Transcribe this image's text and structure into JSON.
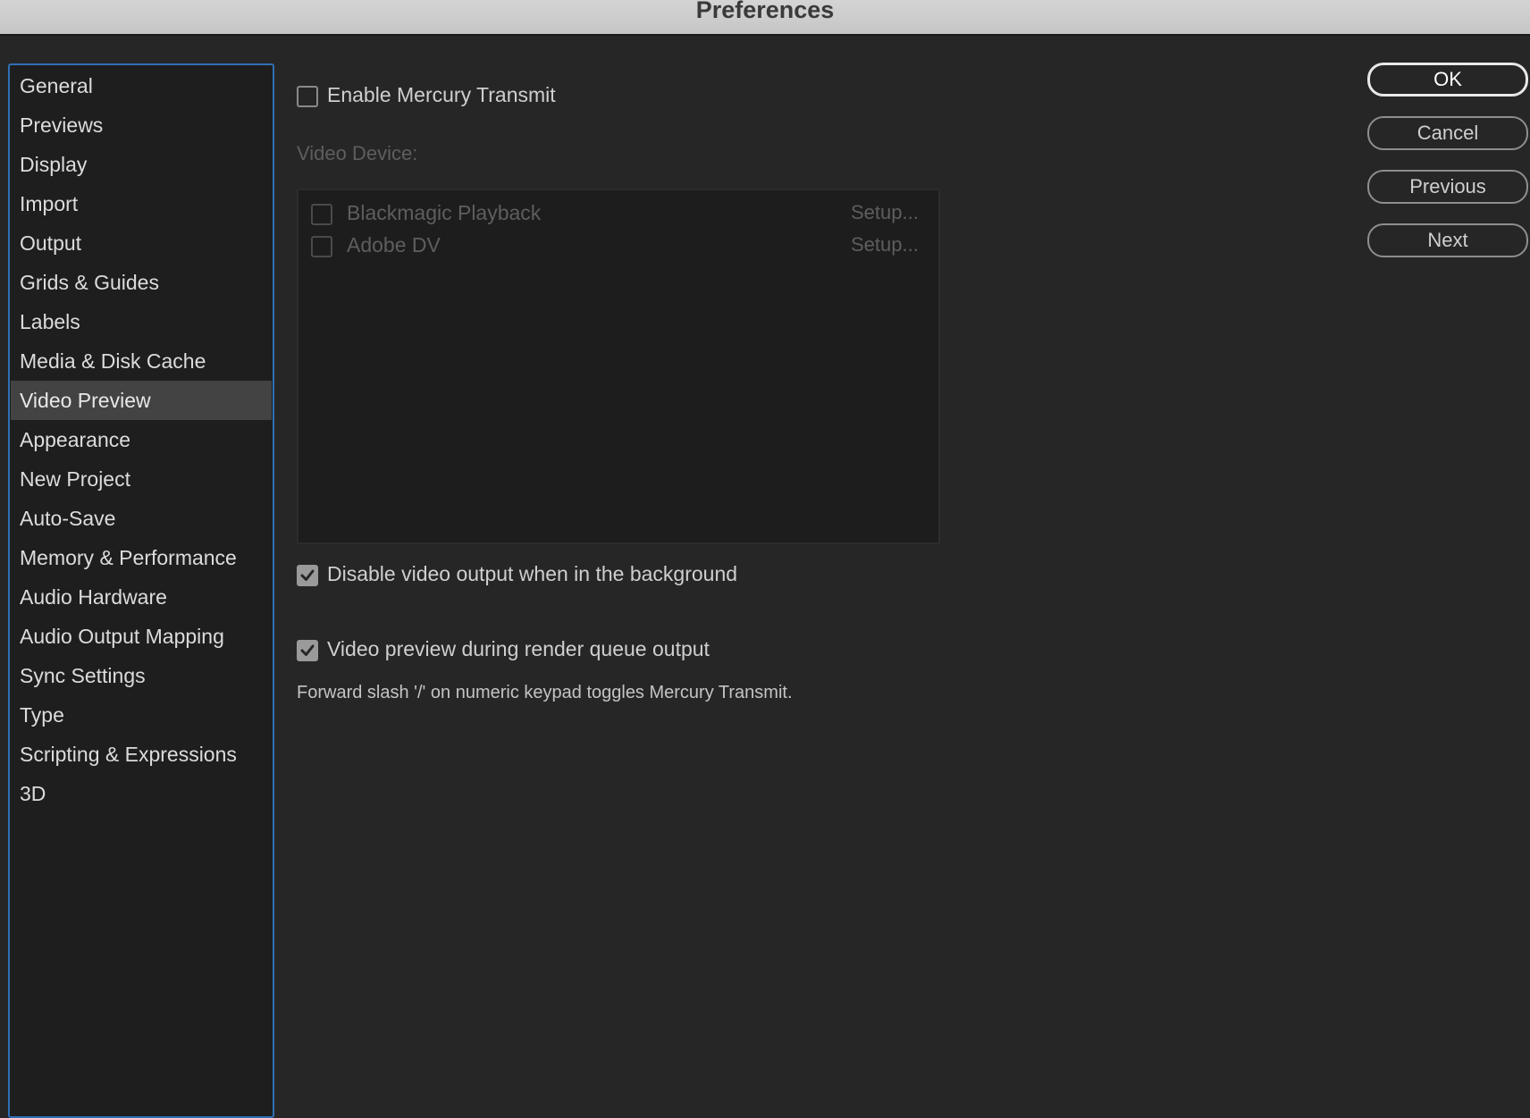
{
  "window": {
    "title": "Preferences"
  },
  "sidebar": {
    "items": [
      {
        "label": "General"
      },
      {
        "label": "Previews"
      },
      {
        "label": "Display"
      },
      {
        "label": "Import"
      },
      {
        "label": "Output"
      },
      {
        "label": "Grids & Guides"
      },
      {
        "label": "Labels"
      },
      {
        "label": "Media & Disk Cache"
      },
      {
        "label": "Video Preview",
        "selected": true
      },
      {
        "label": "Appearance"
      },
      {
        "label": "New Project"
      },
      {
        "label": "Auto-Save"
      },
      {
        "label": "Memory & Performance"
      },
      {
        "label": "Audio Hardware"
      },
      {
        "label": "Audio Output Mapping"
      },
      {
        "label": "Sync Settings"
      },
      {
        "label": "Type"
      },
      {
        "label": "Scripting & Expressions"
      },
      {
        "label": "3D"
      }
    ]
  },
  "main": {
    "enable_mercury_transmit": {
      "label": "Enable Mercury Transmit",
      "checked": false
    },
    "video_device_label": "Video Device:",
    "devices": [
      {
        "name": "Blackmagic Playback",
        "setup_label": "Setup...",
        "checked": false
      },
      {
        "name": "Adobe DV",
        "setup_label": "Setup...",
        "checked": false
      }
    ],
    "disable_background": {
      "label": "Disable video output when in the background",
      "checked": true
    },
    "render_queue_preview": {
      "label": "Video preview during render queue output",
      "checked": true
    },
    "hint": "Forward slash '/' on numeric keypad toggles Mercury Transmit."
  },
  "buttons": {
    "ok": "OK",
    "cancel": "Cancel",
    "previous": "Previous",
    "next": "Next"
  }
}
